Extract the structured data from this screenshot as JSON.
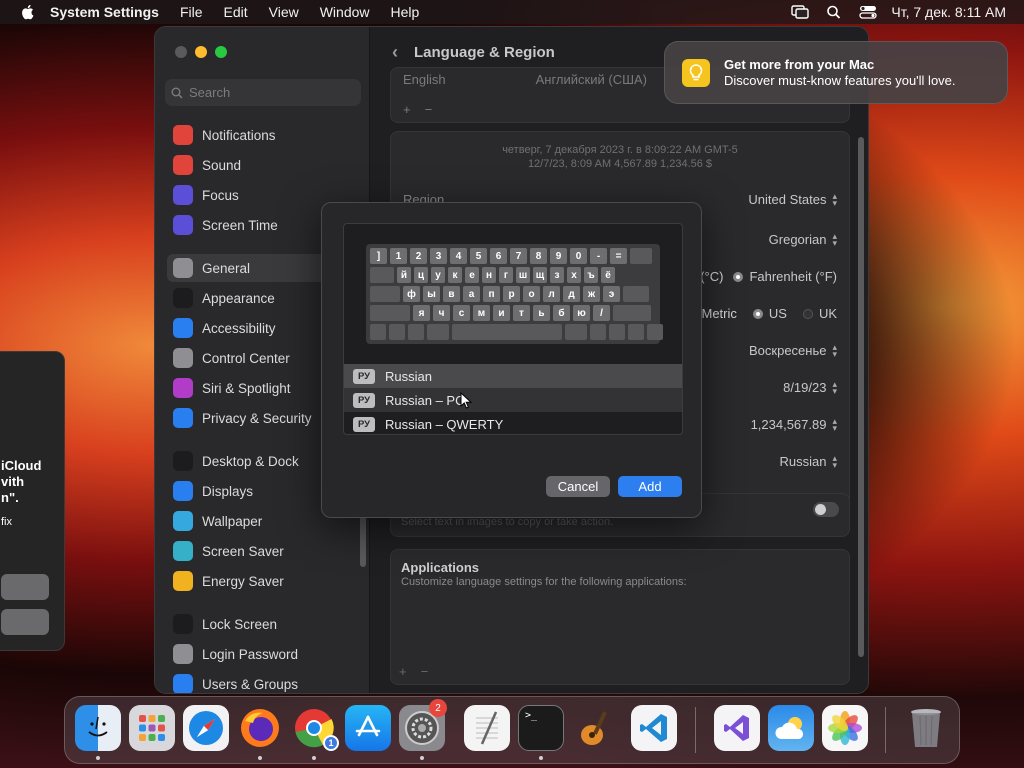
{
  "menubar": {
    "app_name": "System Settings",
    "menus": [
      "File",
      "Edit",
      "View",
      "Window",
      "Help"
    ],
    "clock": "Чт, 7 дек.  8:11 AM"
  },
  "settings": {
    "search_placeholder": "Search",
    "title": "Language & Region",
    "sidebar": [
      {
        "label": "Notifications",
        "icon": "bell-icon",
        "color": "#e0443a"
      },
      {
        "label": "Sound",
        "icon": "speaker-icon",
        "color": "#e0443a"
      },
      {
        "label": "Focus",
        "icon": "moon-icon",
        "color": "#5a4fd6"
      },
      {
        "label": "Screen Time",
        "icon": "hourglass-icon",
        "color": "#5a4fd6"
      },
      {
        "label": "General",
        "icon": "gear-icon",
        "color": "#8e8e93"
      },
      {
        "label": "Appearance",
        "icon": "appearance-icon",
        "color": "#1c1c1e"
      },
      {
        "label": "Accessibility",
        "icon": "accessibility-icon",
        "color": "#2a7ff0"
      },
      {
        "label": "Control Center",
        "icon": "control-center-icon",
        "color": "#8e8e93"
      },
      {
        "label": "Siri & Spotlight",
        "icon": "siri-icon",
        "color": "#b03cc8"
      },
      {
        "label": "Privacy & Security",
        "icon": "hand-icon",
        "color": "#2a7ff0"
      },
      {
        "label": "Desktop & Dock",
        "icon": "dock-icon",
        "color": "#1c1c1e"
      },
      {
        "label": "Displays",
        "icon": "display-icon",
        "color": "#2a7ff0"
      },
      {
        "label": "Wallpaper",
        "icon": "wallpaper-icon",
        "color": "#35a8e0"
      },
      {
        "label": "Screen Saver",
        "icon": "screensaver-icon",
        "color": "#35b0c8"
      },
      {
        "label": "Energy Saver",
        "icon": "battery-icon",
        "color": "#f0b21e"
      },
      {
        "label": "Lock Screen",
        "icon": "lock-icon",
        "color": "#1c1c1e"
      },
      {
        "label": "Login Password",
        "icon": "key-icon",
        "color": "#8e8e93"
      },
      {
        "label": "Users & Groups",
        "icon": "users-icon",
        "color": "#2a7ff0"
      }
    ],
    "languages_first": {
      "name": "English",
      "value": "Английский (США)"
    },
    "preview_line1": "четверг, 7 декабря 2023 г. в 8:09:22 AM GMT-5",
    "preview_line2": "12/7/23, 8:09 AM     4,567.89     1,234.56 $",
    "region_label": "Region",
    "region_value": "United States",
    "calendar_value": "Gregorian",
    "temp_c": "(°C)",
    "temp_f": "Fahrenheit (°F)",
    "measure_metric": "Metric",
    "measure_us": "US",
    "measure_uk": "UK",
    "first_day": "Воскресенье",
    "date_format": "8/19/23",
    "number_format": "1,234,567.89",
    "list_sort": "Russian",
    "live_text_desc": "Select text in images to copy or take action.",
    "apps_title": "Applications",
    "apps_desc": "Customize language settings for the following applications:"
  },
  "notification": {
    "title": "Get more from your Mac",
    "body": "Discover must-know features you'll love."
  },
  "left_panel": {
    "line1": "iCloud",
    "line2": "vith",
    "line3": "n\".",
    "line4": "fix"
  },
  "keyboard": {
    "row1": [
      "]",
      "1",
      "2",
      "3",
      "4",
      "5",
      "6",
      "7",
      "8",
      "9",
      "0",
      "-",
      "="
    ],
    "row2": [
      "й",
      "ц",
      "у",
      "к",
      "е",
      "н",
      "г",
      "ш",
      "щ",
      "з",
      "х",
      "ъ",
      "ё"
    ],
    "row3": [
      "ф",
      "ы",
      "в",
      "а",
      "п",
      "р",
      "о",
      "л",
      "д",
      "ж",
      "э"
    ],
    "row4": [
      "я",
      "ч",
      "с",
      "м",
      "и",
      "т",
      "ь",
      "б",
      "ю",
      "/"
    ]
  },
  "sheet": {
    "options": [
      {
        "badge": "РУ",
        "label": "Russian"
      },
      {
        "badge": "РУ",
        "label": "Russian – PC"
      },
      {
        "badge": "РУ",
        "label": "Russian – QWERTY"
      }
    ],
    "cancel_label": "Cancel",
    "add_label": "Add"
  },
  "dock": {
    "apps": [
      {
        "name": "Finder",
        "icon": "finder-icon"
      },
      {
        "name": "Launchpad",
        "icon": "launchpad-icon"
      },
      {
        "name": "Safari",
        "icon": "safari-icon"
      },
      {
        "name": "Firefox",
        "icon": "firefox-icon"
      },
      {
        "name": "Chrome",
        "icon": "chrome-icon",
        "badge": "1"
      },
      {
        "name": "App Store",
        "icon": "app-store-icon"
      },
      {
        "name": "System Settings",
        "icon": "settings-icon",
        "badge": "2"
      },
      {
        "name": "TextEdit",
        "icon": "textedit-icon"
      },
      {
        "name": "Terminal",
        "icon": "terminal-icon"
      },
      {
        "name": "GarageBand",
        "icon": "garageband-icon"
      },
      {
        "name": "Visual Studio Code",
        "icon": "vscode-icon"
      },
      {
        "name": "Visual Studio",
        "icon": "visual-studio-icon"
      },
      {
        "name": "Weather",
        "icon": "weather-icon"
      },
      {
        "name": "Photos",
        "icon": "photos-icon"
      },
      {
        "name": "Trash",
        "icon": "trash-icon"
      }
    ],
    "settings_badge": "2",
    "chrome_badge": "1"
  },
  "colors": {
    "accent": "#2d7ff0",
    "close": "#ff5f57",
    "min": "#febc2e",
    "zoom": "#28c840"
  }
}
